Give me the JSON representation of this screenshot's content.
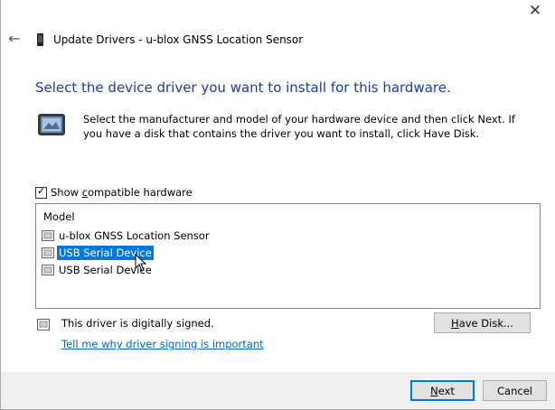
{
  "window": {
    "title": "Update Drivers - u-blox GNSS Location Sensor",
    "close_glyph": "✕",
    "back_glyph": "←"
  },
  "heading": "Select the device driver you want to install for this hardware.",
  "instructions": "Select the manufacturer and model of your hardware device and then click Next. If you have a disk that contains the driver you want to install, click Have Disk.",
  "compatible_checkbox": {
    "checked": true,
    "label_pre": "Show ",
    "label_accel": "c",
    "label_post": "ompatible hardware"
  },
  "model_list": {
    "header": "Model",
    "items": [
      {
        "label": "u-blox GNSS Location Sensor",
        "selected": false
      },
      {
        "label": "USB Serial Device",
        "selected": true
      },
      {
        "label": "USB Serial Device",
        "selected": false
      }
    ]
  },
  "signing": {
    "status": "This driver is digitally signed.",
    "link": "Tell me why driver signing is important"
  },
  "buttons": {
    "have_disk_accel": "H",
    "have_disk_rest": "ave Disk...",
    "next_accel": "N",
    "next_rest": "ext",
    "cancel": "Cancel"
  },
  "colors": {
    "heading": "#1e3e96",
    "selection": "#0078d7",
    "link": "#0066cc"
  },
  "icons": {
    "title": "device-icon",
    "hardware": "hardware-device-icon",
    "list_item": "driver-icon",
    "signed": "signed-driver-icon",
    "cursor": "mouse-pointer-icon"
  }
}
